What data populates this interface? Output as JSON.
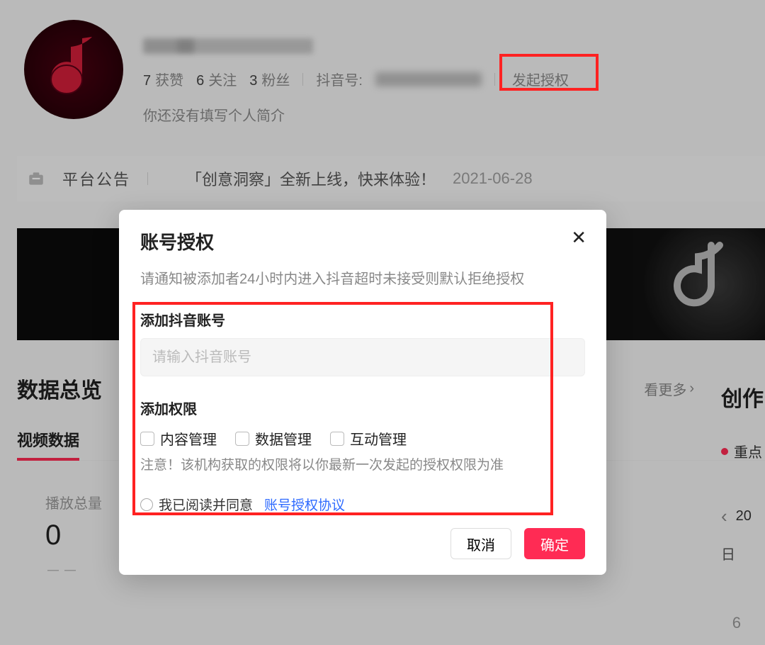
{
  "profile": {
    "stats": {
      "likes_num": "7",
      "likes_label": "获赞",
      "follow_num": "6",
      "follow_label": "关注",
      "fans_num": "3",
      "fans_label": "粉丝"
    },
    "douyin_label": "抖音号:",
    "auth_button": "发起授权",
    "bio_placeholder": "你还没有填写个人简介"
  },
  "notice": {
    "label": "平台公告",
    "text": "「创意洞察」全新上线，快来体验！",
    "date": "2021-06-28"
  },
  "overview": {
    "title": "数据总览",
    "see_more": "看更多",
    "tab_video": "视频数据",
    "metric1_label": "播放总量",
    "metric1_value": "0",
    "metric1_sub": "－－",
    "metric2_sub": "－－",
    "metric3_sub": "－－"
  },
  "right": {
    "title": "创作",
    "item": "重点",
    "date_frag": "20",
    "day": "日",
    "nav_prev": "‹"
  },
  "page_number": "6",
  "modal": {
    "title": "账号授权",
    "subtitle": "请通知被添加者24小时内进入抖音超时未接受则默认拒绝授权",
    "field_account_label": "添加抖音账号",
    "field_account_placeholder": "请输入抖音账号",
    "field_perm_label": "添加权限",
    "perm_content": "内容管理",
    "perm_data": "数据管理",
    "perm_interact": "互动管理",
    "perm_note": "注意！该机构获取的权限将以你最新一次发起的授权权限为准",
    "agree_prefix": "我已阅读并同意",
    "agree_link": "账号授权协议",
    "btn_cancel": "取消",
    "btn_confirm": "确定"
  }
}
